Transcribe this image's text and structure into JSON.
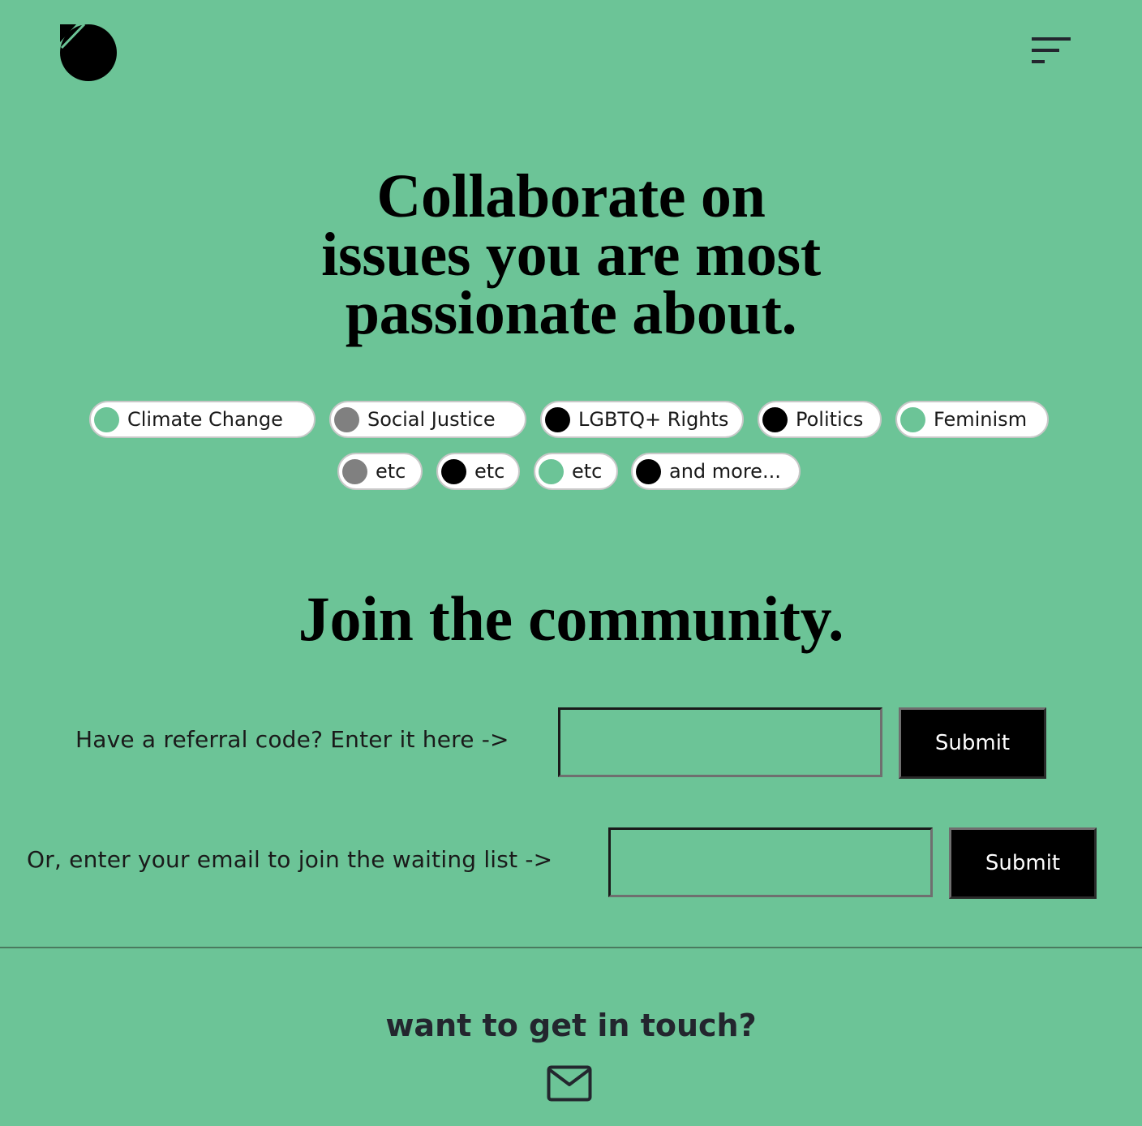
{
  "colors": {
    "background": "#6cc497",
    "chip_bg": "#ffffff",
    "dot_green": "#6cc497",
    "dot_gray": "#808080",
    "dot_black": "#000000",
    "button_bg": "#000000",
    "footer_text": "#23262e"
  },
  "header": {
    "logo_icon": "circle-logo-icon",
    "menu_icon": "hamburger-menu-icon"
  },
  "hero": {
    "title_lines": [
      "Collaborate on",
      "issues you are most",
      "passionate about."
    ]
  },
  "topics": {
    "chips": [
      {
        "label": "Climate Change",
        "dot": "green"
      },
      {
        "label": "Social Justice",
        "dot": "gray"
      },
      {
        "label": "LGBTQ+ Rights",
        "dot": "black"
      },
      {
        "label": "Politics",
        "dot": "black"
      },
      {
        "label": "Feminism",
        "dot": "green"
      },
      {
        "label": "etc",
        "dot": "gray"
      },
      {
        "label": "etc",
        "dot": "black"
      },
      {
        "label": "etc",
        "dot": "green"
      },
      {
        "label": "and more...",
        "dot": "black"
      }
    ]
  },
  "join": {
    "title": "Join the community.",
    "referral": {
      "label": "Have a referral code? Enter it here ->",
      "value": "",
      "submit_label": "Submit"
    },
    "waitlist": {
      "label": "Or, enter your email to join the waiting list ->",
      "value": "",
      "submit_label": "Submit"
    }
  },
  "footer": {
    "title": "want to get in touch?",
    "contact_icon": "mail-icon"
  }
}
